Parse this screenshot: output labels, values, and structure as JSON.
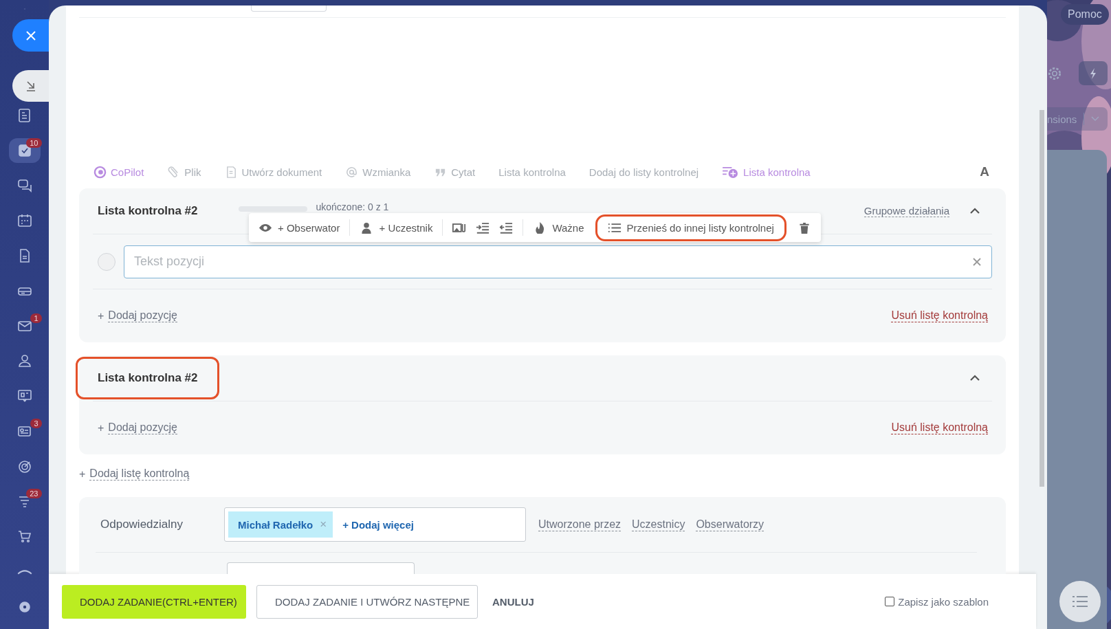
{
  "sidebar": {
    "items": [
      {
        "selected": false
      },
      {
        "selected": true,
        "badge": "10"
      },
      {
        "selected": false
      },
      {
        "selected": false
      },
      {
        "selected": false
      },
      {
        "selected": false
      },
      {
        "selected": false,
        "badge": "1"
      },
      {
        "selected": false
      },
      {
        "selected": false
      },
      {
        "selected": false,
        "badge": "3"
      },
      {
        "selected": false
      },
      {
        "selected": false,
        "badge": "23"
      },
      {
        "selected": false
      },
      {
        "selected": false
      },
      {
        "selected": false
      }
    ]
  },
  "editor_toolbar": {
    "items": [
      {
        "label": "CoPilot",
        "kind": "copilot"
      },
      {
        "label": "Plik",
        "kind": "file"
      },
      {
        "label": "Utwórz dokument",
        "kind": "document"
      },
      {
        "label": "Wzmianka",
        "kind": "mention"
      },
      {
        "label": "Cytat",
        "kind": "quote"
      },
      {
        "label": "Lista kontrolna",
        "kind": "plain"
      },
      {
        "label": "Dodaj do listy kontrolnej",
        "kind": "plain"
      },
      {
        "label": "Lista kontrolna",
        "kind": "ai-checklist"
      }
    ],
    "format_button": "A"
  },
  "checklists": [
    {
      "title": "Lista kontrolna #2",
      "title_highlighted": false,
      "expanded": true,
      "progress": {
        "level": 0,
        "text": "ukończone: 0 z 1"
      },
      "group_actions": "Grupowe działania",
      "items": [
        {
          "placeholder": "Tekst pozycji",
          "checked": false
        }
      ],
      "item_toolbar": [
        {
          "kind": "observer",
          "label": "+ Obserwator",
          "highlighted": false
        },
        {
          "kind": "participant",
          "label": "+ Uczestnik",
          "highlighted": false
        },
        {
          "kind": "attach",
          "highlighted": false
        },
        {
          "kind": "indent",
          "highlighted": false
        },
        {
          "kind": "outdent",
          "highlighted": false
        },
        {
          "kind": "important",
          "label": "Ważne",
          "highlighted": false
        },
        {
          "kind": "move",
          "label": "Przenieś do innej listy kontrolnej",
          "highlighted": true
        },
        {
          "kind": "delete",
          "highlighted": false
        }
      ],
      "add_item": {
        "icon": "+",
        "label": "Dodaj pozycję"
      },
      "remove": "Usuń listę kontrolną"
    },
    {
      "title": "Lista kontrolna #2",
      "title_highlighted": true,
      "expanded": true,
      "add_item": {
        "icon": "+",
        "label": "Dodaj pozycję"
      },
      "remove": "Usuń listę kontrolną"
    }
  ],
  "add_checklist": {
    "icon": "+",
    "label": "Dodaj listę kontrolną"
  },
  "responsible": {
    "label": "Odpowiedzialny",
    "tags": [
      {
        "name": "Michał Radełko",
        "remove": "×"
      }
    ],
    "add_more": "+ Dodaj więcej",
    "links": [
      "Utworzone przez",
      "Uczestnicy",
      "Obserwatorzy"
    ]
  },
  "footer": {
    "primary": "DODAJ ZADANIE(CTRL+ENTER)",
    "secondary": "DODAJ ZADANIE I UTWÓRZ NASTĘPNE",
    "cancel": "ANULUJ",
    "template": {
      "label": "Zapisz jako szablon",
      "checked": false
    }
  },
  "background": {
    "help": "Pomoc",
    "cut_text": "nsions"
  }
}
